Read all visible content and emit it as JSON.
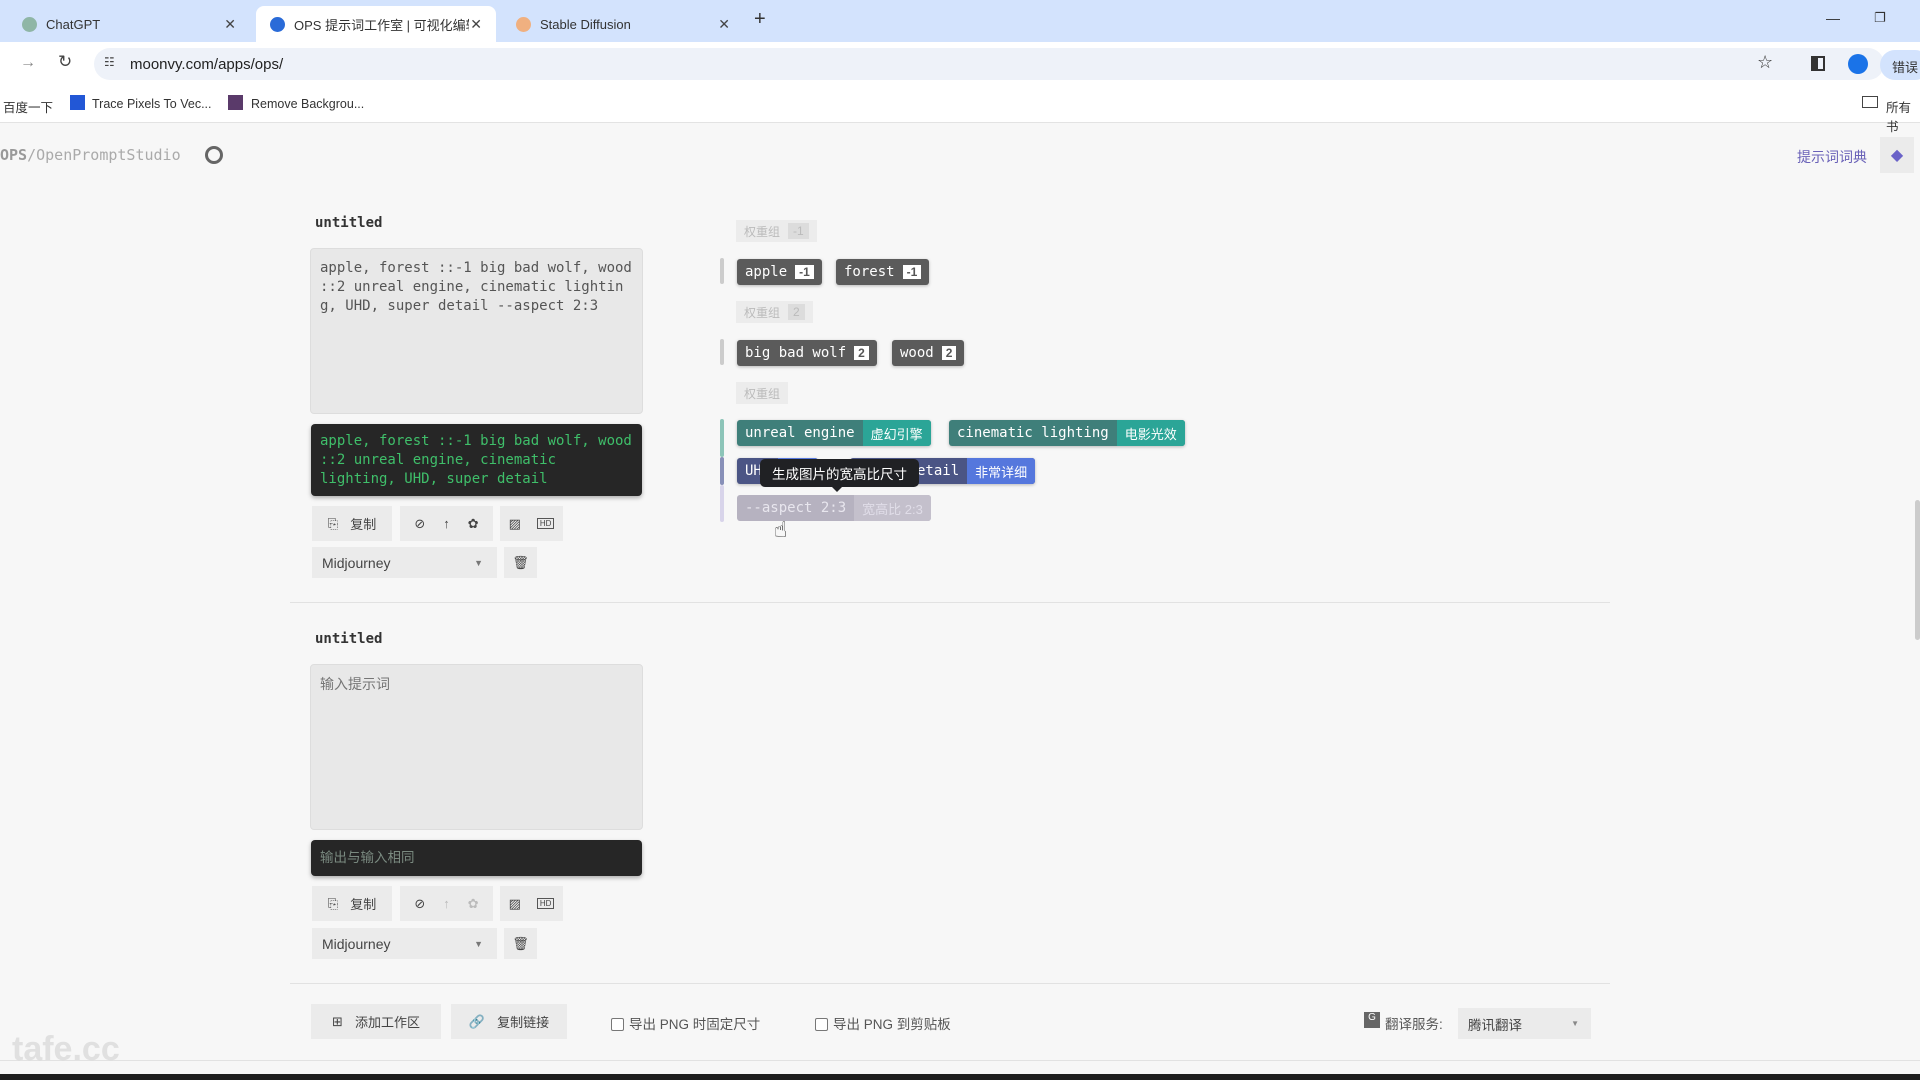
{
  "browser": {
    "tabs": [
      {
        "label": "ChatGPT",
        "active": false
      },
      {
        "label": "OPS 提示词工作室 | 可视化编辑",
        "active": true
      },
      {
        "label": "Stable Diffusion",
        "active": false
      }
    ],
    "url": "moonvy.com/apps/ops/",
    "bookmarks": [
      "百度一下",
      "Trace Pixels To Vec...",
      "Remove Backgrou..."
    ],
    "all_bookmarks": "所有书",
    "error_label": "错误"
  },
  "header": {
    "brand": "OPS",
    "name": "/OpenPromptStudio",
    "dict_link": "提示词词典"
  },
  "workspaces": [
    {
      "title": "untitled",
      "input": "apple, forest ::-1 big bad wolf, wood ::2 unreal engine, cinematic lighting, UHD, super detail --aspect 2:3",
      "input_placeholder": "输入提示词",
      "output": "apple, forest ::-1 big bad wolf, wood ::2 unreal engine, cinematic lighting, UHD, super detail",
      "copy_label": "复制",
      "model": "Midjourney"
    },
    {
      "title": "untitled",
      "input": "",
      "input_placeholder": "输入提示词",
      "output": "输出与输入相同",
      "copy_label": "复制",
      "model": "Midjourney"
    }
  ],
  "tags": {
    "group1_label": "权重组",
    "group1_weight": "-1",
    "group1": [
      {
        "text": "apple",
        "weight": "-1"
      },
      {
        "text": "forest",
        "weight": "-1"
      }
    ],
    "group2_label": "权重组",
    "group2_weight": "2",
    "group2": [
      {
        "text": "big bad wolf",
        "weight": "2"
      },
      {
        "text": "wood",
        "weight": "2"
      }
    ],
    "group3_label": "权重组",
    "group3": [
      {
        "text": "unreal engine",
        "tr": "虚幻引擎"
      },
      {
        "text": "cinematic lighting",
        "tr": "电影光效"
      },
      {
        "text": "UHD",
        "tr": ""
      },
      {
        "text": "super detail",
        "tr": "非常详细"
      }
    ],
    "param": {
      "text": "--aspect 2:3",
      "tr": "宽高比 2:3"
    },
    "tooltip": "生成图片的宽高比尺寸",
    "colors": {
      "weighted": "#5b5b5b",
      "style": "#3f7f7a",
      "style_tr": "#2ba597",
      "quality": "#4b5585",
      "quality_tr": "#5577dd",
      "param": "#b6b2c0"
    }
  },
  "footer": {
    "add_workspace": "添加工作区",
    "copy_link": "复制链接",
    "export_fixed": "导出 PNG 时固定尺寸",
    "export_clipboard": "导出 PNG 到剪贴板",
    "translate_label": "翻译服务:",
    "translate_value": "腾讯翻译"
  },
  "watermark": "tafe.cc"
}
